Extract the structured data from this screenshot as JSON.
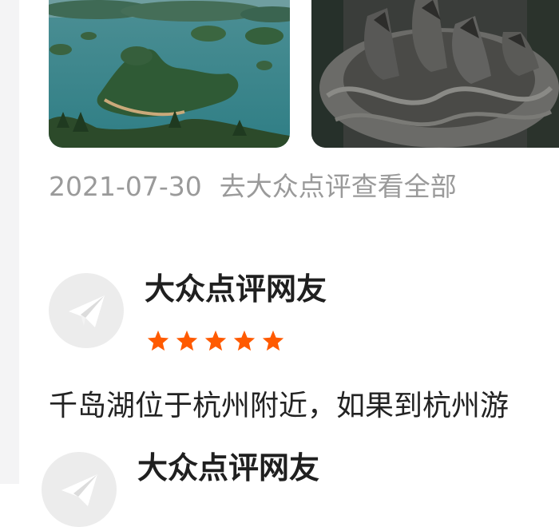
{
  "photos": [
    {
      "icon": "lake-islands-photo"
    },
    {
      "icon": "stone-sculpture-photo"
    }
  ],
  "review_meta": {
    "date": "2021-07-30",
    "link": "去大众点评查看全部"
  },
  "reviews": [
    {
      "user": "大众点评网友",
      "avatar_icon": "paper-plane-icon",
      "rating": 5,
      "text": "千岛湖位于杭州附近，如果到杭州游"
    },
    {
      "user": "大众点评网友",
      "avatar_icon": "paper-plane-icon"
    }
  ],
  "colors": {
    "star": "#ff5a00",
    "meta_text": "#9a9a9a",
    "avatar_bg": "#ececec"
  }
}
